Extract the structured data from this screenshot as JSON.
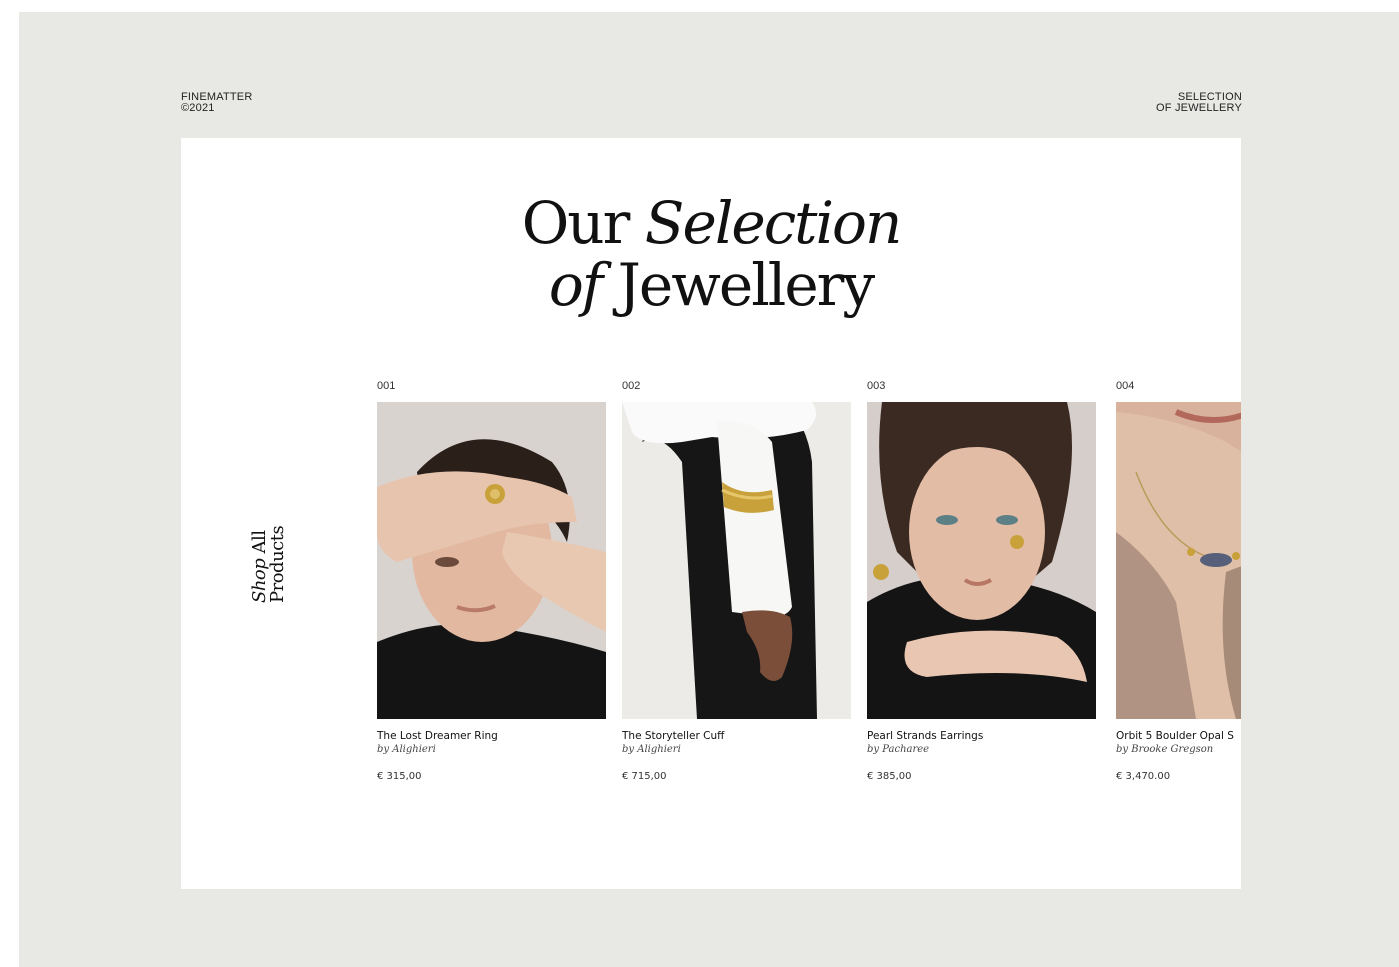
{
  "brand": {
    "name": "FINEMATTER",
    "year": "©2021"
  },
  "section_label": {
    "line1": "SELECTION",
    "line2": "OF JEWELLERY"
  },
  "headline": {
    "w1": "Our",
    "w2": "Selection",
    "w3": "of",
    "w4": "Jewellery"
  },
  "shop_all": {
    "w1": "Shop",
    "w2": "All",
    "w3": "Products"
  },
  "products": [
    {
      "number": "001",
      "name": "The Lost Dreamer Ring",
      "by": "by Alighieri",
      "price": "€ 315,00"
    },
    {
      "number": "002",
      "name": "The Storyteller Cuff",
      "by": "by Alighieri",
      "price": "€ 715,00"
    },
    {
      "number": "003",
      "name": "Pearl Strands Earrings",
      "by": "by Pacharee",
      "price": "€ 385,00"
    },
    {
      "number": "004",
      "name": "Orbit 5 Boulder Opal S",
      "by": "by Brooke Gregson",
      "price": "€ 3,470.00"
    }
  ],
  "colors": {
    "page_background": "#e8e8e5",
    "card_background": "#ffffff",
    "text": "#111111",
    "gold": "#c9a13b"
  },
  "icons": [
    "product-photo-ring",
    "product-photo-cuff",
    "product-photo-earrings",
    "product-photo-necklace"
  ]
}
